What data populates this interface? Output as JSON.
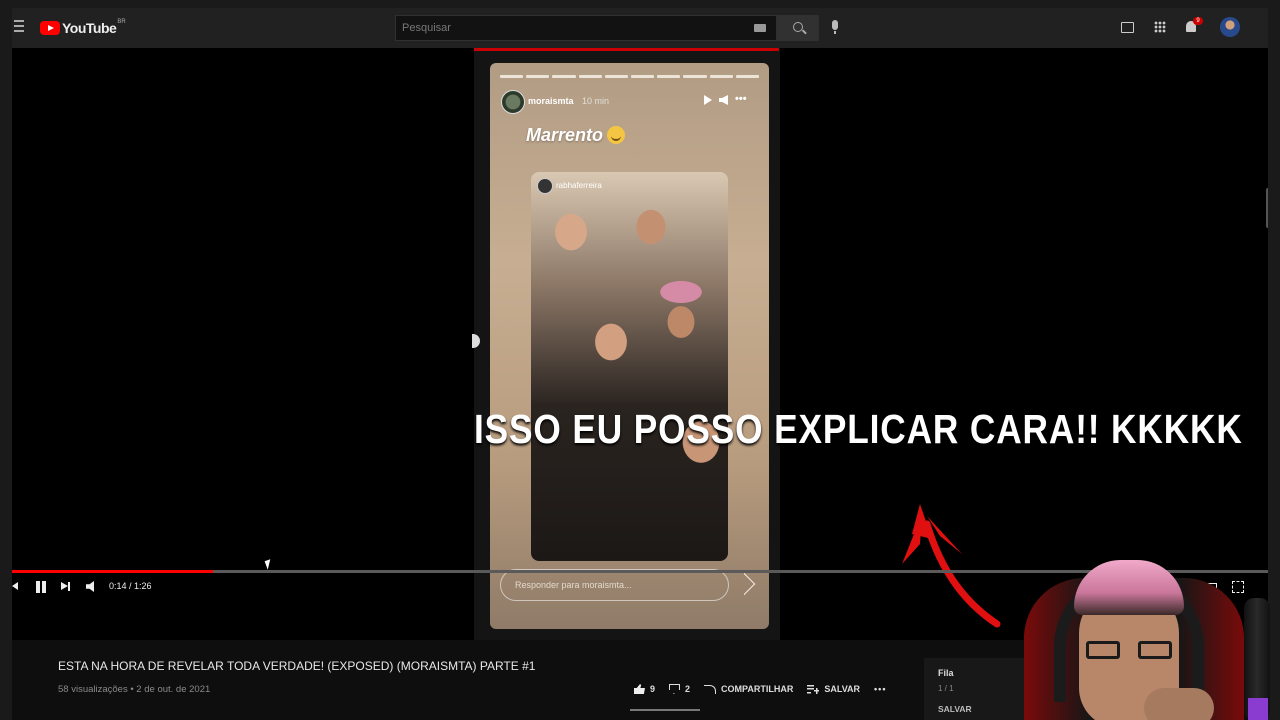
{
  "header": {
    "logo_text": "YouTube",
    "logo_country": "BR",
    "search_placeholder": "Pesquisar",
    "notification_count": "9"
  },
  "story": {
    "username": "moraismta",
    "time": "10 min",
    "caption": "Marrento",
    "photo_username": "rabhaferreira",
    "reply_placeholder": "Responder para moraismta..."
  },
  "overlay_caption": "ISSO EU POSSO EXPLICAR CARA!! KKKKK",
  "controls": {
    "time": "0:14 / 1:26",
    "progress_fraction": 0.16
  },
  "video": {
    "title": "ESTA NA HORA DE REVELAR TODA VERDADE! (EXPOSED) (MORAISMTA) PARTE #1",
    "meta": "58 visualizações • 2 de out. de 2021",
    "likes": "9",
    "dislikes": "2",
    "share_label": "COMPARTILHAR",
    "save_label": "SALVAR",
    "more_label": "•••"
  },
  "queue": {
    "label": "Fila",
    "count": "1 / 1",
    "save_label": "SALVAR"
  },
  "colors": {
    "accent": "#ff0000",
    "arrow": "#e01010"
  }
}
